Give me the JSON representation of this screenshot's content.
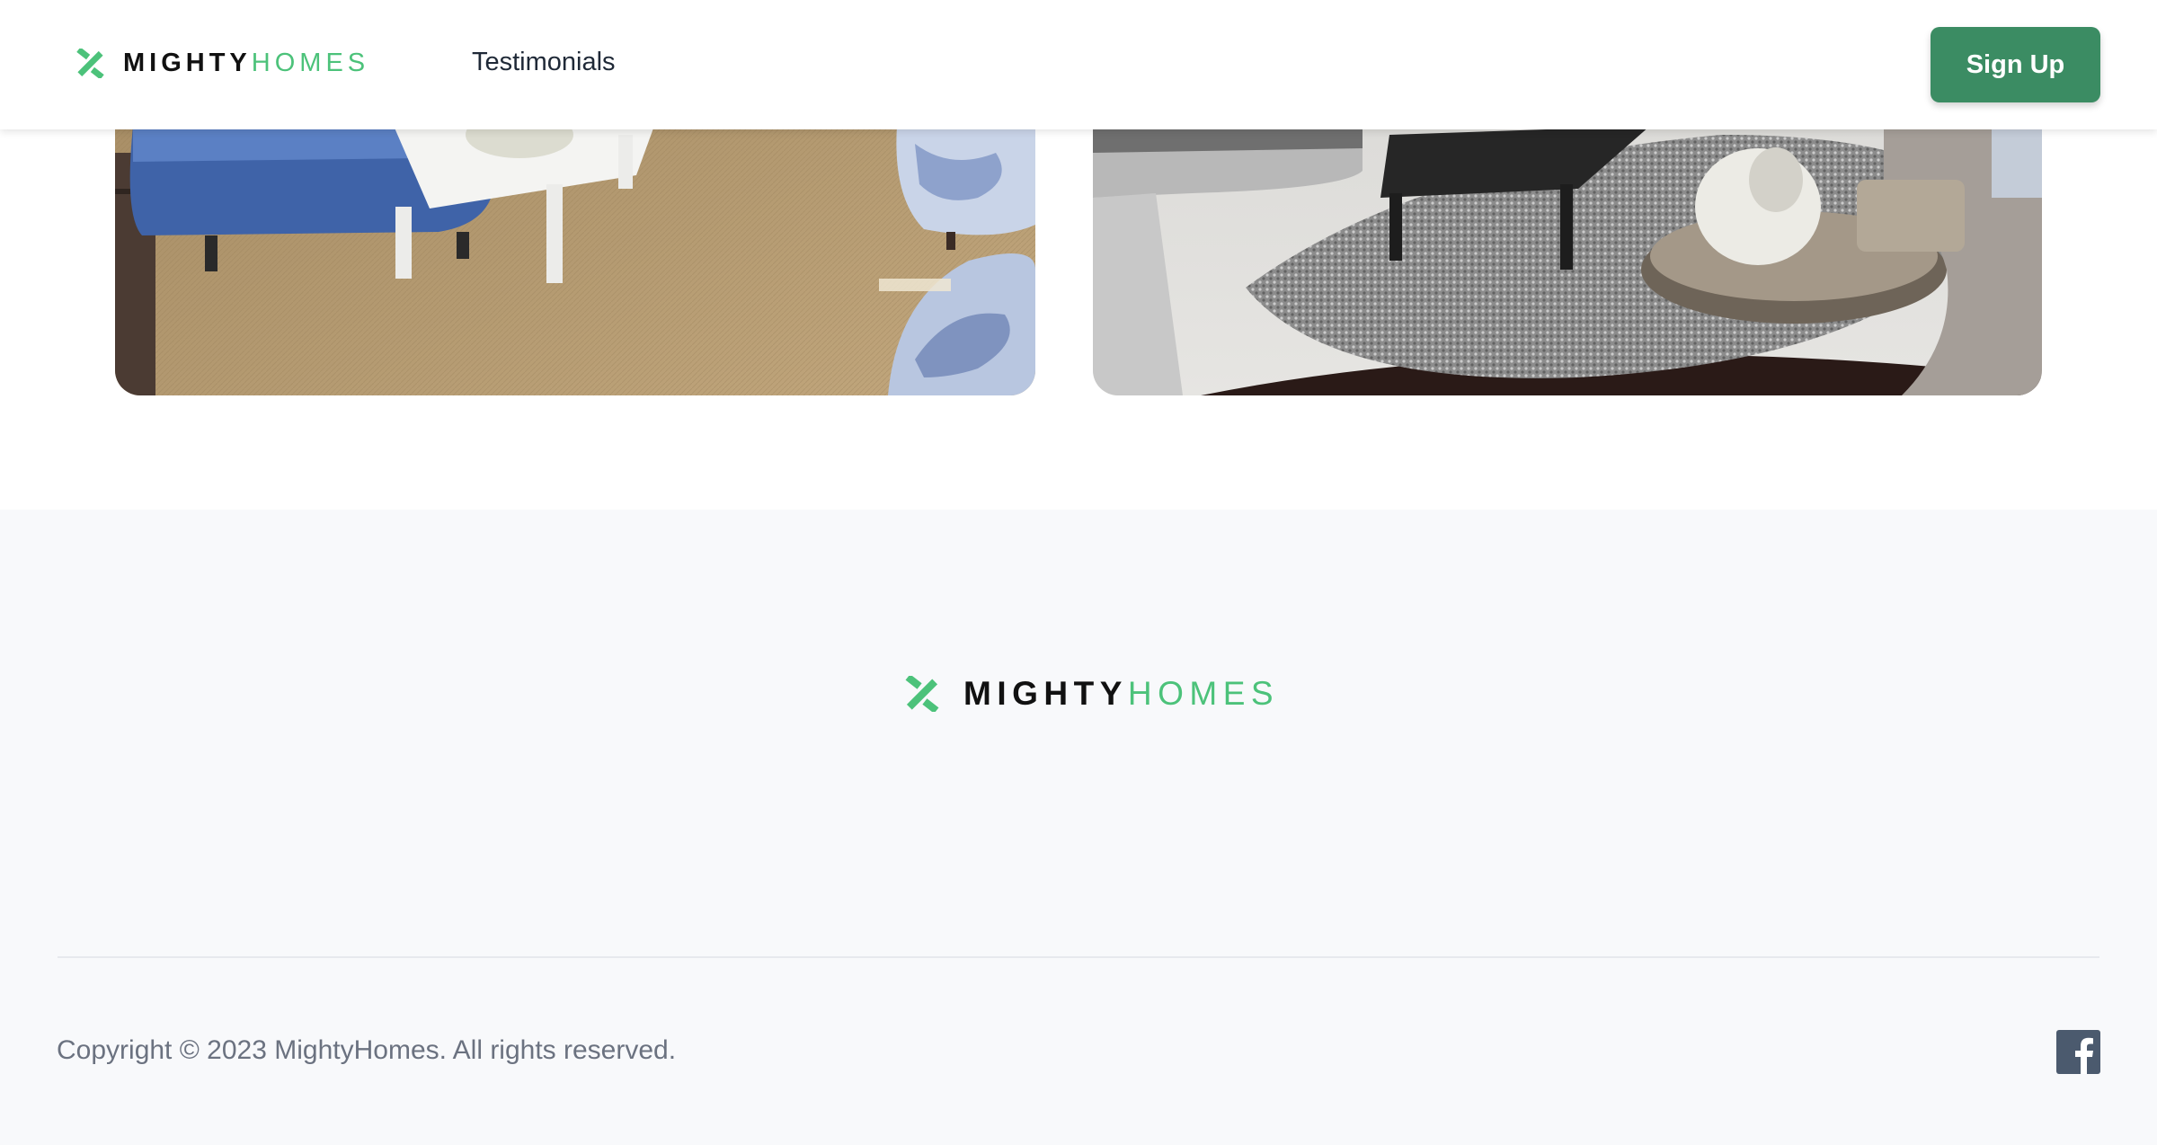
{
  "header": {
    "brand": {
      "word1": "MIGHTY",
      "word2": "HOMES"
    },
    "nav": [
      {
        "label": "Testimonials"
      }
    ],
    "signup_label": "Sign Up"
  },
  "gallery": {
    "images": [
      {
        "icon": "living-room-photo-blue-sofa"
      },
      {
        "icon": "living-room-photo-grey-sofa"
      }
    ]
  },
  "footer": {
    "brand": {
      "word1": "MIGHTY",
      "word2": "HOMES"
    },
    "copyright": "Copyright © 2023 MightyHomes. All rights reserved.",
    "social": [
      {
        "icon": "facebook-icon"
      }
    ]
  },
  "colors": {
    "brand_green": "#4cc27a",
    "button_green": "#3b8c63",
    "footer_bg": "#f8f9fb",
    "muted_text": "#6b7280",
    "facebook_slate": "#4b5a6e"
  }
}
